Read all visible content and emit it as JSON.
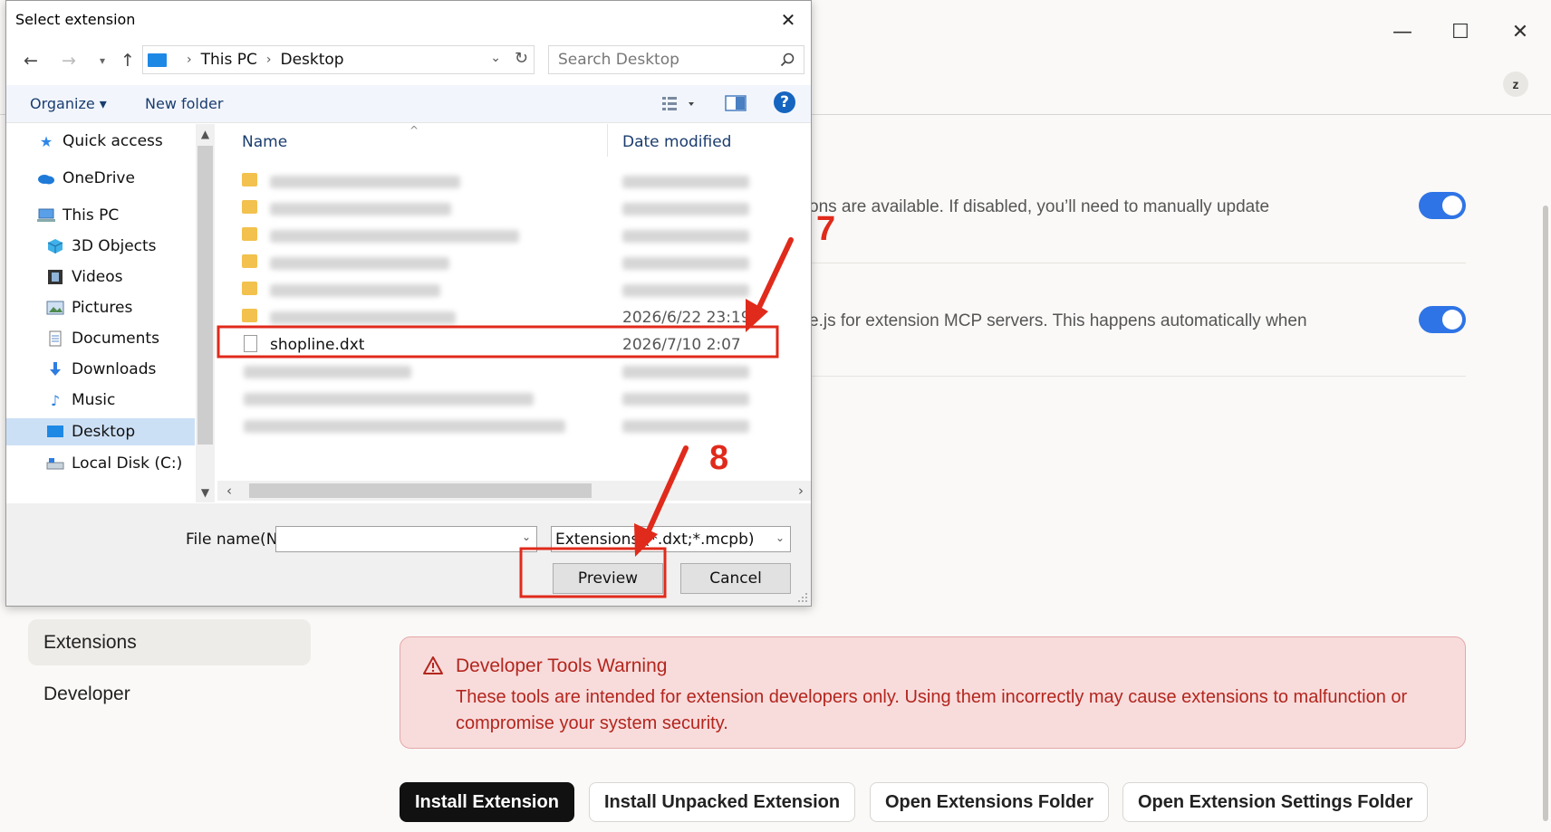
{
  "app": {
    "avatar_initial": "z",
    "settings": [
      {
        "text": "ons are available. If disabled, you’ll need to manually update",
        "enabled": true
      },
      {
        "text": "e.js for extension MCP servers. This happens automatically when",
        "enabled": true
      }
    ],
    "sidebar": {
      "items": [
        {
          "label": "Extensions",
          "selected": true
        },
        {
          "label": "Developer",
          "selected": false
        }
      ]
    },
    "warning": {
      "title": "Developer Tools Warning",
      "body": "These tools are intended for extension developers only. Using them incorrectly may cause extensions to malfunction or compromise your system security."
    },
    "actions": {
      "install": "Install Extension",
      "install_unpacked": "Install Unpacked Extension",
      "open_folder": "Open Extensions Folder",
      "open_settings_folder": "Open Extension Settings Folder"
    }
  },
  "dialog": {
    "title": "Select extension",
    "breadcrumb": [
      "This PC",
      "Desktop"
    ],
    "search_placeholder": "Search Desktop",
    "commands": {
      "organize": "Organize",
      "new_folder": "New folder"
    },
    "nav_items": [
      {
        "label": "Quick access",
        "icon": "star-icon"
      },
      {
        "label": "OneDrive",
        "icon": "cloud-icon"
      },
      {
        "label": "This PC",
        "icon": "computer-icon"
      },
      {
        "label": "3D Objects",
        "icon": "cube-icon"
      },
      {
        "label": "Videos",
        "icon": "film-icon"
      },
      {
        "label": "Pictures",
        "icon": "picture-icon"
      },
      {
        "label": "Documents",
        "icon": "document-icon"
      },
      {
        "label": "Downloads",
        "icon": "download-icon"
      },
      {
        "label": "Music",
        "icon": "music-icon"
      },
      {
        "label": "Desktop",
        "icon": "desktop-icon",
        "selected": true
      },
      {
        "label": "Local Disk (C:)",
        "icon": "disk-icon"
      }
    ],
    "columns": {
      "name": "Name",
      "date": "Date modified"
    },
    "visible_date": "2026/6/22 23:19",
    "highlighted_file": {
      "name": "shopline.dxt",
      "date": "2026/7/10 2:07"
    },
    "file_name_label": "File name(N):",
    "file_name_value": "",
    "filter": "Extensions (*.dxt;*.mcpb)",
    "buttons": {
      "preview": "Preview",
      "cancel": "Cancel"
    }
  },
  "annotations": {
    "step_7": "7",
    "step_8": "8",
    "color": "#e02a1b"
  }
}
